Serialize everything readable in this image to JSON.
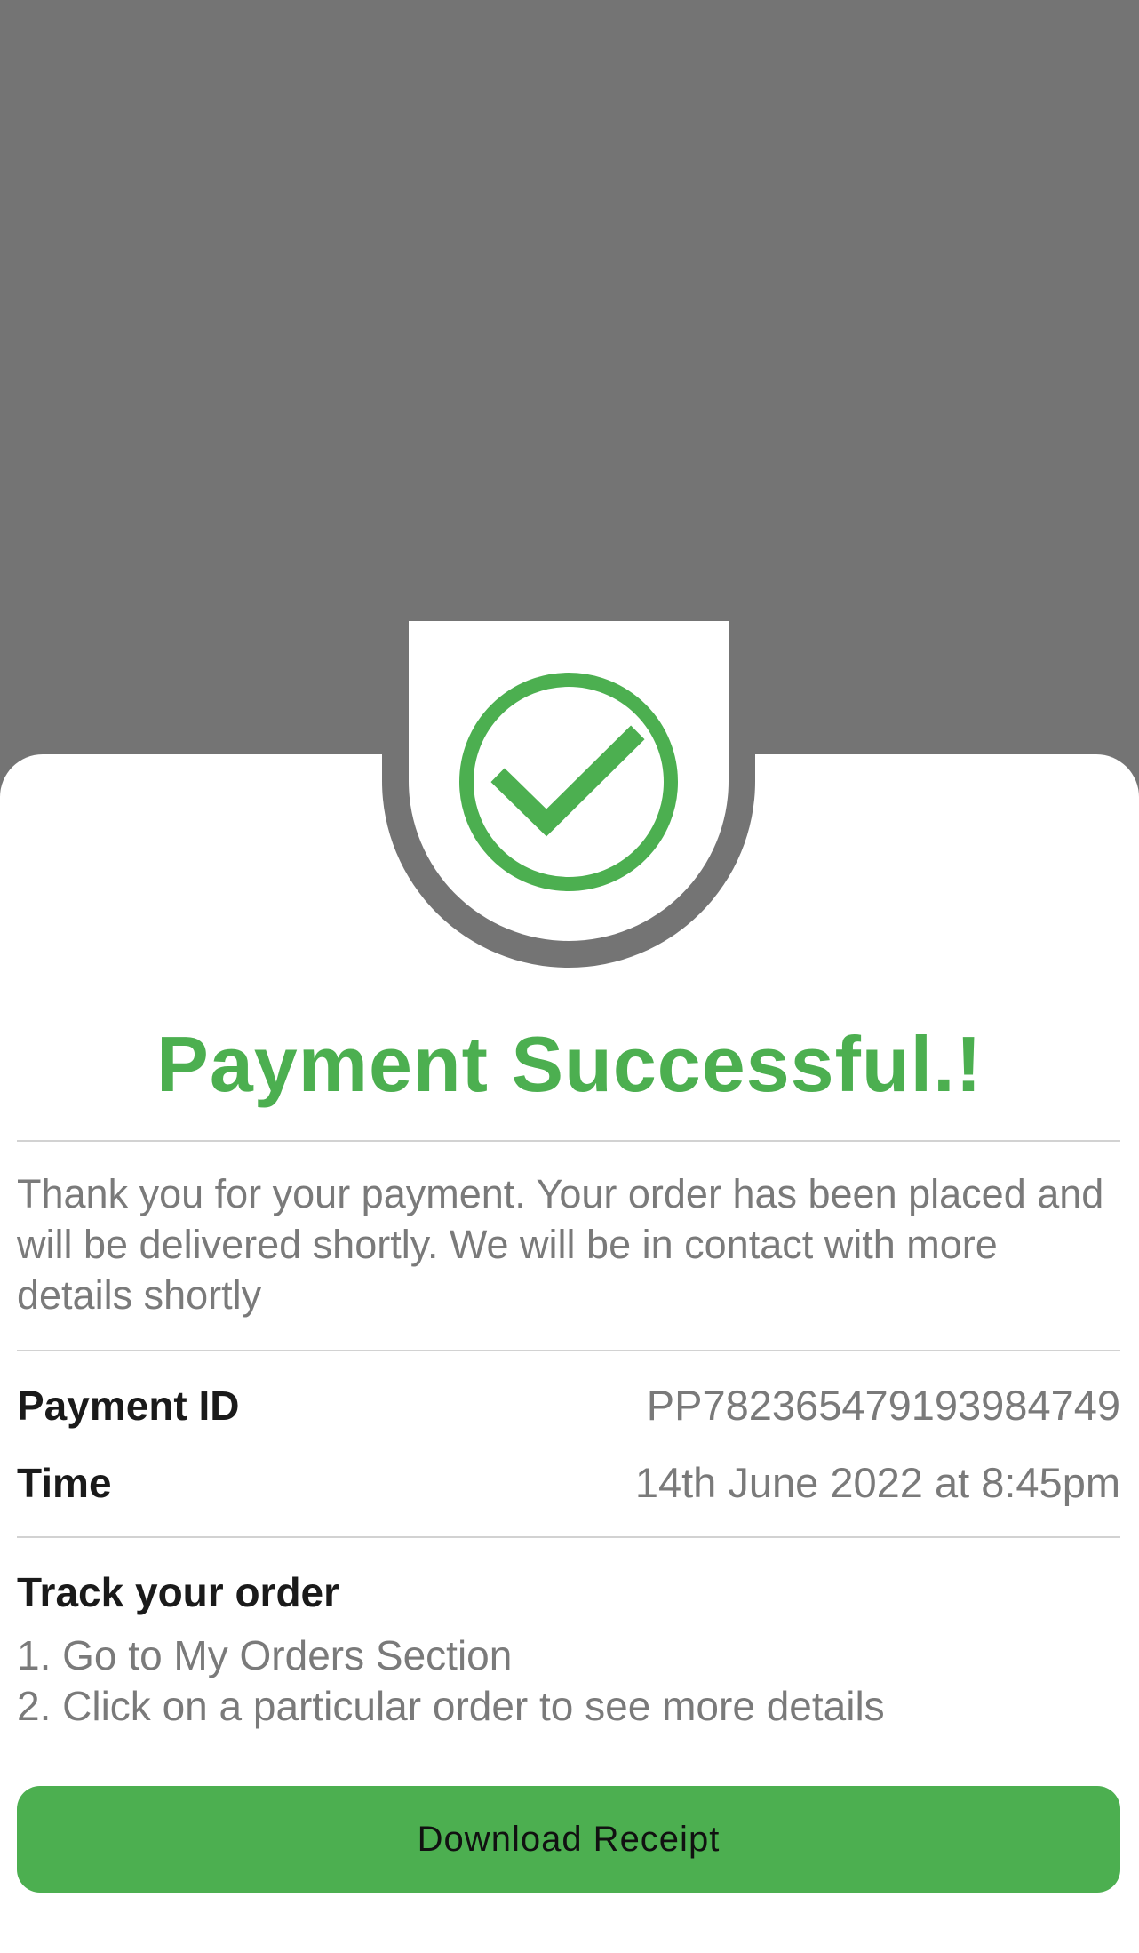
{
  "colors": {
    "accent": "#4caf50",
    "backdrop": "#747474",
    "sheet": "#ffffff",
    "muted_text": "#7a7a7a",
    "strong_text": "#1a1a1a"
  },
  "status": {
    "icon": "check-circle-icon",
    "title": "Payment Successful.!"
  },
  "message": "Thank you for your payment. Your order has been placed and will be delivered shortly. We will be in contact with more details shortly",
  "details": {
    "payment_id_label": "Payment ID",
    "payment_id_value": "PP782365479193984749",
    "time_label": "Time",
    "time_value": "14th June 2022 at 8:45pm"
  },
  "tracking": {
    "heading": "Track your order",
    "steps": [
      "1. Go to My Orders Section",
      "2. Click on a particular order to see more details"
    ]
  },
  "actions": {
    "download_label": "Download Receipt"
  }
}
